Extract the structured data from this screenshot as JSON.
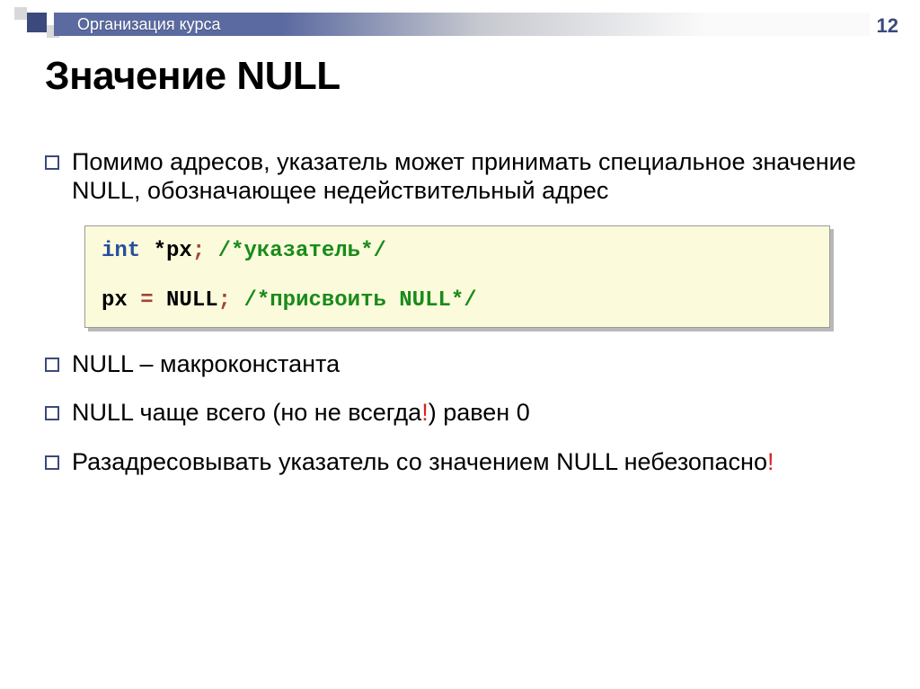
{
  "header": {
    "breadcrumb": "Организация курса",
    "page_number": "12"
  },
  "title": "Значение NULL",
  "bullets": {
    "b1": "Помимо адресов, указатель может принимать специальное значение NULL, обозначающее недействительный адрес",
    "b2": "NULL – макроконстанта",
    "b3_pre": "NULL чаще всего (но не всегда",
    "b3_excl": "!",
    "b3_post": ") равен 0",
    "b4_pre": "Разадресовывать указатель со значением NULL небезопасно",
    "b4_excl": "!"
  },
  "code": {
    "l1_type": "int",
    "l1_decl": " *px",
    "l1_semi": ";",
    "l1_sp": " ",
    "l1_comment": "/*указатель*/",
    "l2_lhs": "px ",
    "l2_eq": "= ",
    "l2_rhs": "NULL",
    "l2_semi": ";",
    "l2_sp": " ",
    "l2_comment": "/*присвоить NULL*/"
  }
}
